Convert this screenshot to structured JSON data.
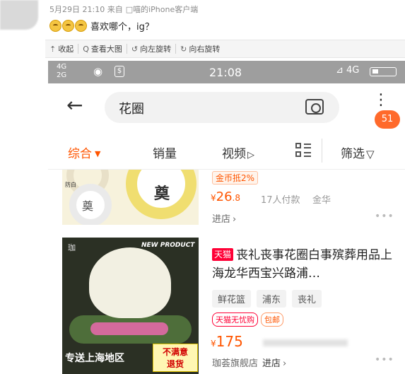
{
  "post": {
    "date": "5月29日 21:10 来自",
    "client": "□喵的iPhone客户端",
    "text": "喜欢哪个，ig？"
  },
  "toolbar": [
    {
      "icon": "collapse-icon",
      "glyph": "⇡",
      "label": "收起"
    },
    {
      "icon": "search-icon",
      "glyph": "Q",
      "label": "查看大图"
    },
    {
      "icon": "rotate-left-icon",
      "glyph": "↺",
      "label": "向左旋转"
    },
    {
      "icon": "rotate-right-icon",
      "glyph": "↻",
      "label": "向右旋转"
    }
  ],
  "status_bar": {
    "network_top": "4G",
    "network_bottom": "2G",
    "weibo_glyph": "◉",
    "s_glyph": "$",
    "time": "21:08",
    "right": "⊿ 4G"
  },
  "search": {
    "query": "花圈",
    "back_glyph": "←",
    "notification_count": "51"
  },
  "tabs": {
    "comprehensive": "综合",
    "sales": "销量",
    "video": "视频",
    "filter": "筛选"
  },
  "item1": {
    "top_tag": "金币抵2%",
    "price_symbol": "¥",
    "price_main": "26",
    "price_decimal": ".8",
    "buyers": "17人付款",
    "location": "金华",
    "store_link": "进店",
    "image_text_1": "奠",
    "image_text_2": "奠",
    "image_label": "防白"
  },
  "item2": {
    "platform_tag": "天猫",
    "title": "丧礼丧事花圈白事殡葬用品上海龙华西宝兴路浦…",
    "chips": [
      "鲜花篮",
      "浦东",
      "丧礼"
    ],
    "tag_worry": "天猫无忧购",
    "tag_shipping": "包邮",
    "price_symbol": "¥",
    "price": "175",
    "store": "珈荟旗舰店",
    "store_link": "进店",
    "image_new": "NEW PRODUCT",
    "image_caption": "专送上海地区",
    "image_refund_1": "不满意",
    "image_refund_2": "退货",
    "image_watermark": "珈"
  },
  "colors": {
    "accent": "#ff5500",
    "tmall_red": "#ff0036",
    "status_bar": "#9e9e9e",
    "badge": "#ff6a2b"
  }
}
